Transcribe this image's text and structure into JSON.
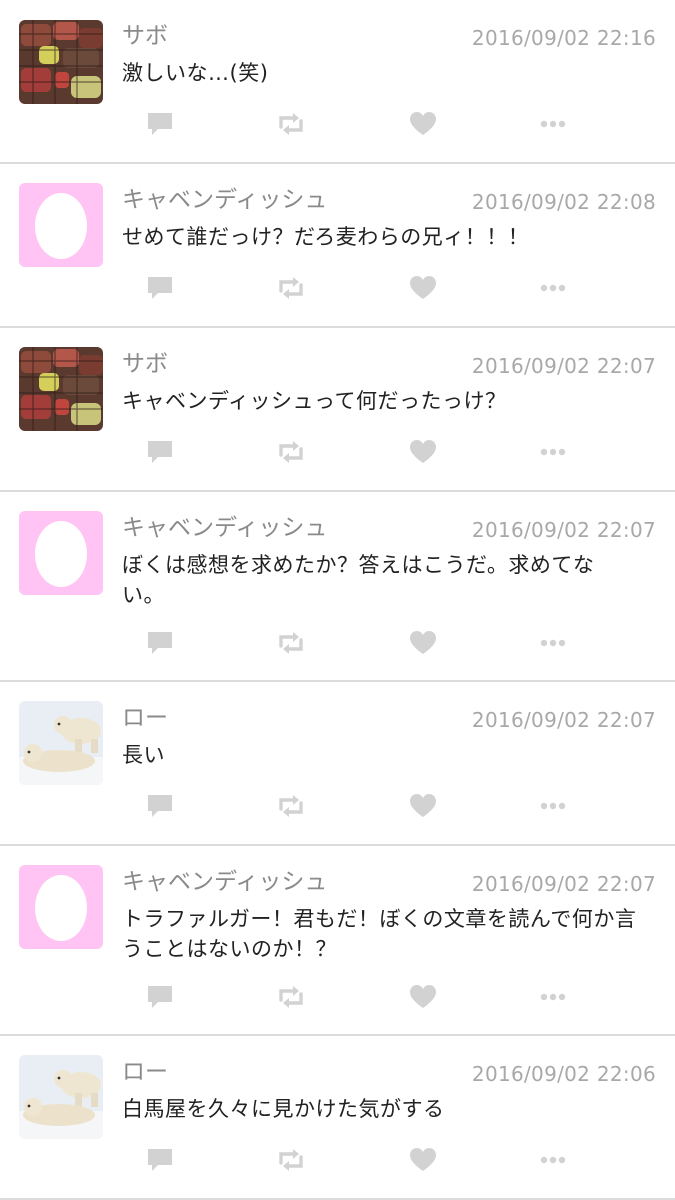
{
  "posts": [
    {
      "author": "サボ",
      "time": "2016/09/02 22:16",
      "text": "激しいな…(笑)",
      "avatar": "grill-avatar-icon"
    },
    {
      "author": "キャベンディッシュ",
      "time": "2016/09/02 22:08",
      "text": "せめて誰だっけ？だろ麦わらの兄ィ！！！",
      "avatar": "egg-avatar-icon"
    },
    {
      "author": "サボ",
      "time": "2016/09/02 22:07",
      "text": "キャベンディッシュって何だったっけ？",
      "avatar": "grill-avatar-icon"
    },
    {
      "author": "キャベンディッシュ",
      "time": "2016/09/02 22:07",
      "text": "ぼくは感想を求めたか？答えはこうだ。求めてない。",
      "avatar": "egg-avatar-icon"
    },
    {
      "author": "ロー",
      "time": "2016/09/02 22:07",
      "text": "長い",
      "avatar": "polar-bear-avatar-icon"
    },
    {
      "author": "キャベンディッシュ",
      "time": "2016/09/02 22:07",
      "text": "トラファルガー！君もだ！ぼくの文章を読んで何か言うことはないのか！？",
      "avatar": "egg-avatar-icon"
    },
    {
      "author": "ロー",
      "time": "2016/09/02 22:06",
      "text": "白馬屋を久々に見かけた気がする",
      "avatar": "polar-bear-avatar-icon"
    }
  ],
  "actions": [
    "reply-icon",
    "retweet-icon",
    "like-icon",
    "more-icon"
  ],
  "colors": {
    "egg_avatar_bg": "#ffc4f4",
    "icon": "#d2d2d2",
    "author": "#8a8a8a",
    "timestamp": "#a8a8a8",
    "text": "#222222"
  }
}
